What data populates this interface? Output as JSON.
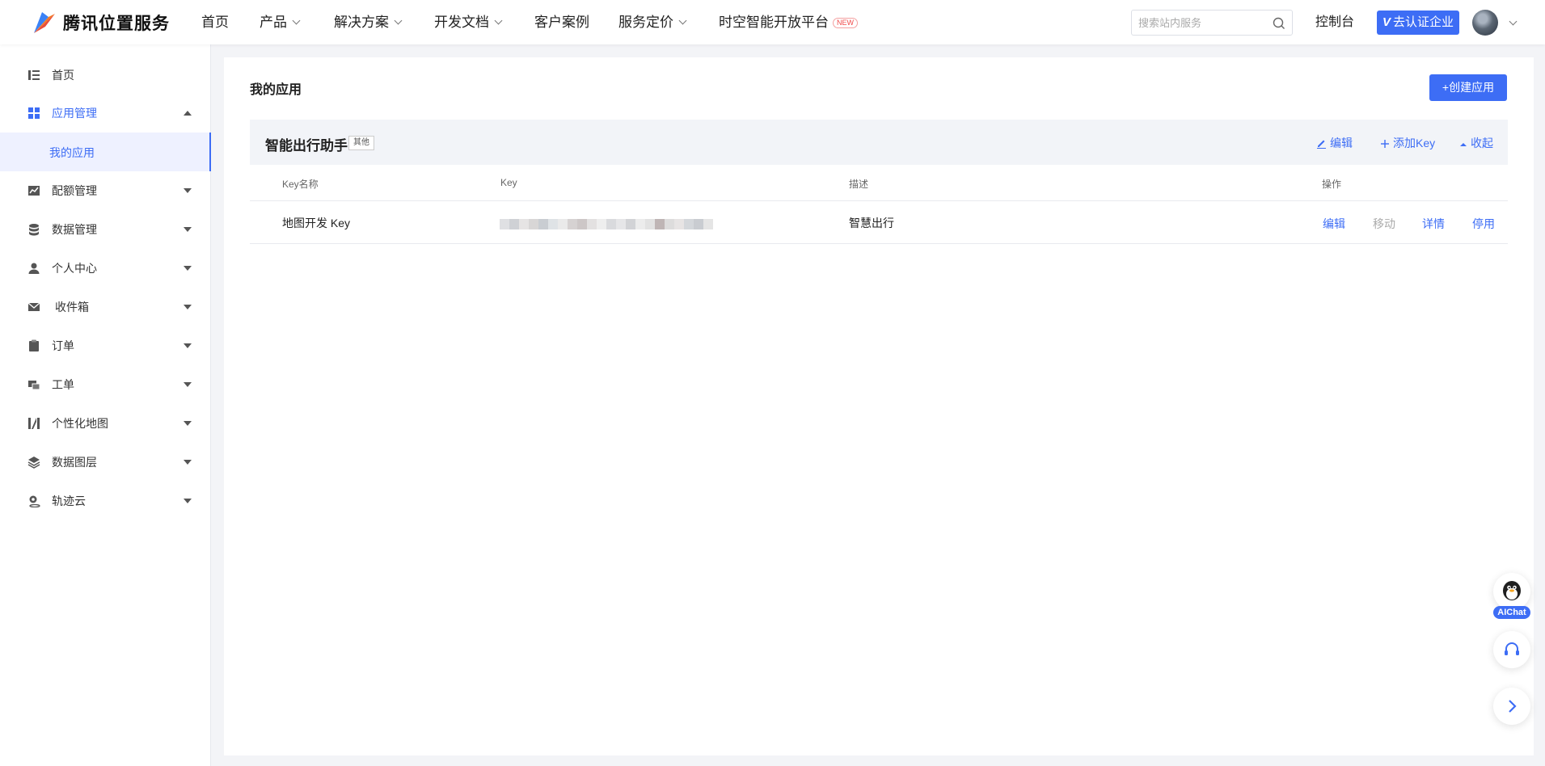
{
  "header": {
    "logo_text": "腾讯位置服务",
    "nav": [
      {
        "label": "首页",
        "dropdown": false
      },
      {
        "label": "产品",
        "dropdown": true
      },
      {
        "label": "解决方案",
        "dropdown": true
      },
      {
        "label": "开发文档",
        "dropdown": true
      },
      {
        "label": "客户案例",
        "dropdown": false
      },
      {
        "label": "服务定价",
        "dropdown": true
      },
      {
        "label": "时空智能开放平台",
        "dropdown": false,
        "badge": "NEW"
      }
    ],
    "search_placeholder": "搜索站内服务",
    "console_label": "控制台",
    "verify_label": "去认证企业",
    "verify_mark": "V"
  },
  "sidebar": {
    "items": [
      {
        "label": "首页",
        "icon": "list-icon",
        "expandable": false
      },
      {
        "label": "应用管理",
        "icon": "grid-icon",
        "expandable": true,
        "expanded": true,
        "active": true
      },
      {
        "label": "配额管理",
        "icon": "chart-icon",
        "expandable": true
      },
      {
        "label": "数据管理",
        "icon": "database-icon",
        "expandable": true
      },
      {
        "label": "个人中心",
        "icon": "user-icon",
        "expandable": true
      },
      {
        "label": "收件箱",
        "icon": "mail-icon",
        "expandable": true
      },
      {
        "label": "订单",
        "icon": "clipboard-icon",
        "expandable": true
      },
      {
        "label": "工单",
        "icon": "ticket-icon",
        "expandable": true
      },
      {
        "label": "个性化地图",
        "icon": "map-style-icon",
        "expandable": true
      },
      {
        "label": "数据图层",
        "icon": "layers-icon",
        "expandable": true
      },
      {
        "label": "轨迹云",
        "icon": "track-icon",
        "expandable": true
      }
    ],
    "sub_active": "我的应用"
  },
  "main": {
    "title": "我的应用",
    "create_label": "创建应用",
    "app": {
      "name": "智能出行助手",
      "tag": "其他",
      "actions": {
        "edit": "编辑",
        "add_key": "添加Key",
        "collapse": "收起"
      },
      "columns": {
        "key_name": "Key名称",
        "key": "Key",
        "desc": "描述",
        "ops": "操作"
      },
      "rows": [
        {
          "key_name": "地图开发 Key",
          "desc": "智慧出行",
          "ops": {
            "edit": "编辑",
            "move": "移动",
            "detail": "详情",
            "disable": "停用"
          }
        }
      ]
    }
  },
  "floating": {
    "aichat_label": "AIChat"
  },
  "colors": {
    "accent": "#3d6df5",
    "disabled": "#aaaaaa"
  }
}
